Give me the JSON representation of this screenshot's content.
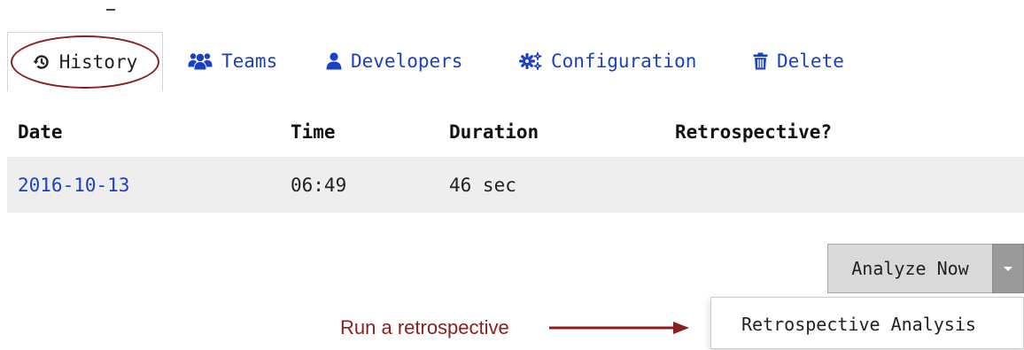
{
  "tabs": [
    {
      "label": "History",
      "icon": "history-icon",
      "active": true
    },
    {
      "label": "Teams",
      "icon": "users-icon"
    },
    {
      "label": "Developers",
      "icon": "user-icon"
    },
    {
      "label": "Configuration",
      "icon": "gears-icon"
    },
    {
      "label": "Delete",
      "icon": "trash-icon"
    }
  ],
  "table": {
    "headers": [
      "Date",
      "Time",
      "Duration",
      "Retrospective?"
    ],
    "rows": [
      {
        "date": "2016-10-13",
        "time": "06:49",
        "duration": "46 sec",
        "retrospective": ""
      }
    ]
  },
  "actions": {
    "analyze_label": "Analyze Now",
    "menu_items": [
      "Retrospective Analysis"
    ]
  },
  "annotation": {
    "text": "Run a retrospective",
    "color": "#8b1f1f"
  },
  "colors": {
    "link": "#1a40c8",
    "row_bg": "#eeeeee",
    "button_bg": "#d9d9d9",
    "caret_bg": "#9a9a9a"
  }
}
